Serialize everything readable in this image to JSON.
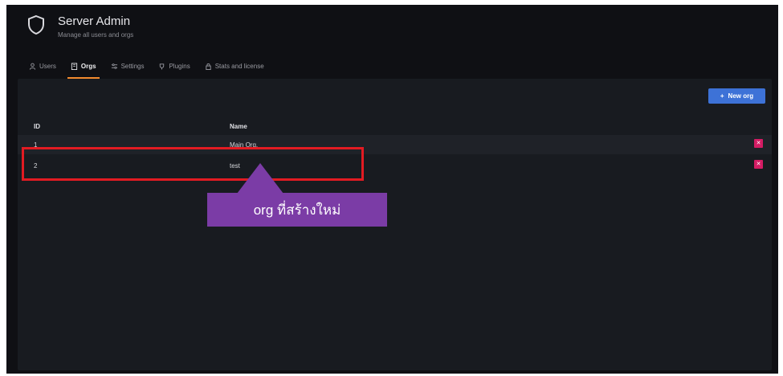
{
  "header": {
    "title": "Server Admin",
    "subtitle": "Manage all users and orgs"
  },
  "tabs": [
    {
      "label": "Users",
      "icon": "user-icon",
      "active": false
    },
    {
      "label": "Orgs",
      "icon": "building-icon",
      "active": true
    },
    {
      "label": "Settings",
      "icon": "sliders-icon",
      "active": false
    },
    {
      "label": "Plugins",
      "icon": "plug-icon",
      "active": false
    },
    {
      "label": "Stats and license",
      "icon": "lock-icon",
      "active": false
    }
  ],
  "toolbar": {
    "new_org_label": "New org",
    "new_org_icon": "plus-icon"
  },
  "table": {
    "columns": [
      "ID",
      "Name"
    ],
    "rows": [
      {
        "id": "1",
        "name": "Main Org.",
        "delete_icon": "close-icon"
      },
      {
        "id": "2",
        "name": "test",
        "delete_icon": "close-icon"
      }
    ]
  },
  "annotation": {
    "text": "org ที่สร้างใหม่"
  },
  "colors": {
    "accent": "#f28a2e",
    "primary_button": "#3d72d7",
    "danger": "#d41c64",
    "highlight_border": "#e21b22",
    "callout_bg": "#7b3ca6"
  }
}
